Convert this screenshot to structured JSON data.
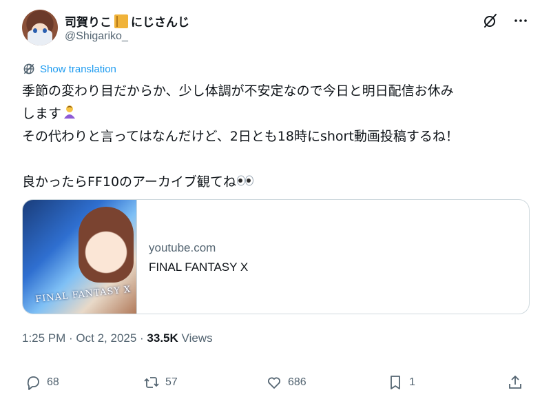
{
  "author": {
    "display_name_prefix": "司賀りこ",
    "display_name_suffix": "にじさんじ",
    "handle": "@Shigariko_"
  },
  "icons": {
    "name_emoji": "notebook-icon",
    "grok": "grok-icon",
    "more": "more-icon",
    "translate": "globe-icon",
    "reply": "reply-icon",
    "retweet": "retweet-icon",
    "like": "heart-icon",
    "bookmark": "bookmark-icon",
    "share": "share-icon"
  },
  "translation": {
    "label": "Show translation"
  },
  "tweet": {
    "line1": "季節の変わり目だからか、少し体調が不安定なので今日と明日配信お休み",
    "line2": "します",
    "line3": "その代わりと言ってはなんだけど、2日とも18時にshort動画投稿するね！",
    "line4": "良かったらFF10のアーカイブ観てね"
  },
  "card": {
    "domain": "youtube.com",
    "title": "FINAL FANTASY X",
    "thumbnail_logo": "FINAL FANTASY X"
  },
  "meta": {
    "time": "1:25 PM",
    "separator": " · ",
    "date": "Oct 2, 2025",
    "views_count": "33.5K",
    "views_label": "Views"
  },
  "actions": {
    "replies": "68",
    "retweets": "57",
    "likes": "686",
    "bookmarks": "1"
  },
  "colors": {
    "accent": "#1d9bf0",
    "text": "#0f1419",
    "muted": "#536471",
    "border": "#cfd9de"
  }
}
